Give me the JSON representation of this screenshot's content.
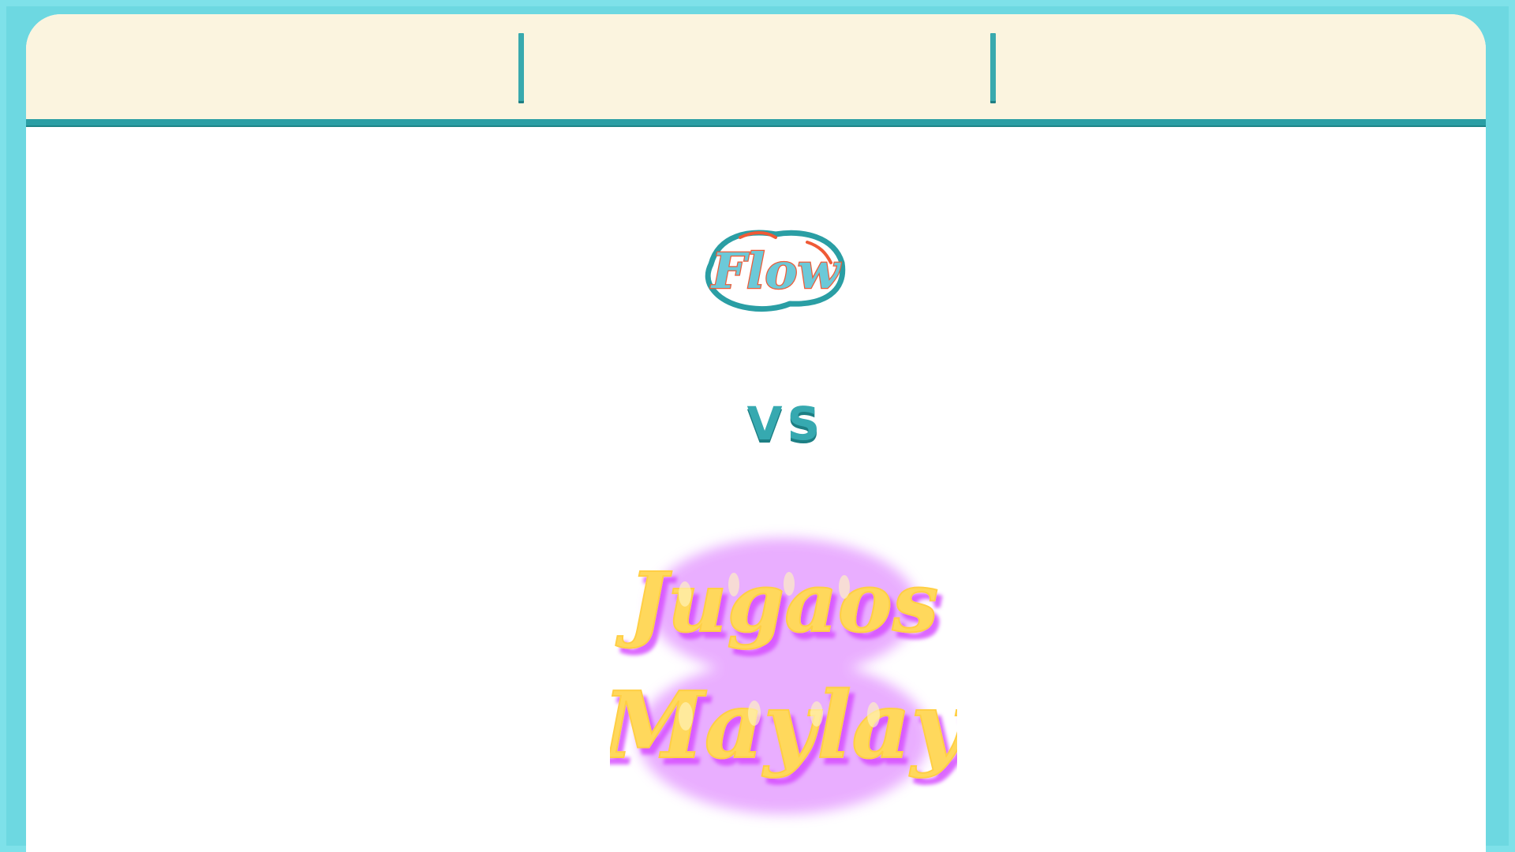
{
  "colors": {
    "frame": "#6dd8e1",
    "topbar": "#fbf4df",
    "accent": "#2a9ea4",
    "panel": "#ffffff",
    "vs_text": "#36a9b0",
    "flow_logo_fill": "#6cc9d8",
    "flow_logo_accent": "#ef5a36",
    "jugaos_logo_fill": "#ffd85c",
    "jugaos_logo_glow": "#c94cff"
  },
  "logos": {
    "flow": {
      "text": "Flow",
      "icon": "flow-logo-icon"
    },
    "jugaos": {
      "text_line1": "Jugaos",
      "text_line2": "Maylay",
      "icon": "jugaos-maylay-logo-icon"
    }
  },
  "versus": {
    "label": "VS"
  },
  "topbar": {
    "dividers": [
      "left-divider",
      "right-divider"
    ]
  }
}
